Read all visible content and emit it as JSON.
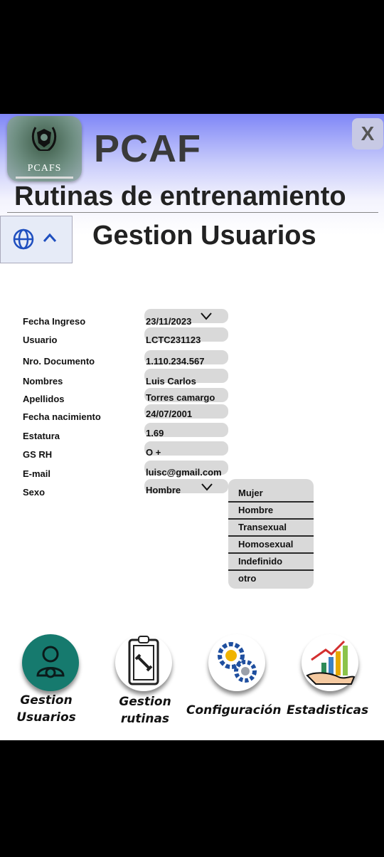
{
  "header": {
    "logo_text": "PCAFS",
    "app_name": "PCAF",
    "close_label": "X",
    "subtitle": "Rutinas de entrenamiento",
    "section_title": "Gestion Usuarios"
  },
  "form": {
    "fields": [
      {
        "label": "Fecha  Ingreso",
        "value": "23/11/2023"
      },
      {
        "label": "Usuario",
        "value": "LCTC231123"
      },
      {
        "label": "Nro. Documento",
        "value": "1.110.234.567"
      },
      {
        "label": "Nombres",
        "value": "Luis Carlos"
      },
      {
        "label": "Apellidos",
        "value": "Torres camargo"
      },
      {
        "label": "Fecha nacimiento",
        "value": "24/07/2001"
      },
      {
        "label": "Estatura",
        "value": "1.69"
      },
      {
        "label": "GS RH",
        "value": "O +"
      },
      {
        "label": "E-mail",
        "value": "luisc@gmail.com"
      },
      {
        "label": "Sexo",
        "value": "Hombre"
      }
    ],
    "sexo_options": [
      "Mujer",
      "Hombre",
      "Transexual",
      "Homosexual",
      "Indefinido",
      "otro"
    ]
  },
  "nav": [
    {
      "line1": "Gestion",
      "line2": "Usuarios"
    },
    {
      "line1": "Gestion",
      "line2": "rutinas"
    },
    {
      "line1": "Configuración"
    },
    {
      "line1": "Estadisticas"
    }
  ],
  "colors": {
    "header_gradient_top": "#7f86f7",
    "field_bg": "#d9d9d9",
    "active_nav": "#167a6e",
    "background": "#ffffff"
  },
  "icons": {
    "language": "globe-icon",
    "collapse": "chevron-up-icon",
    "dropdown": "chevron-down-icon",
    "nav": [
      "user-gear-icon",
      "clipboard-dumbbell-icon",
      "gears-icon",
      "chart-hand-icon"
    ]
  }
}
